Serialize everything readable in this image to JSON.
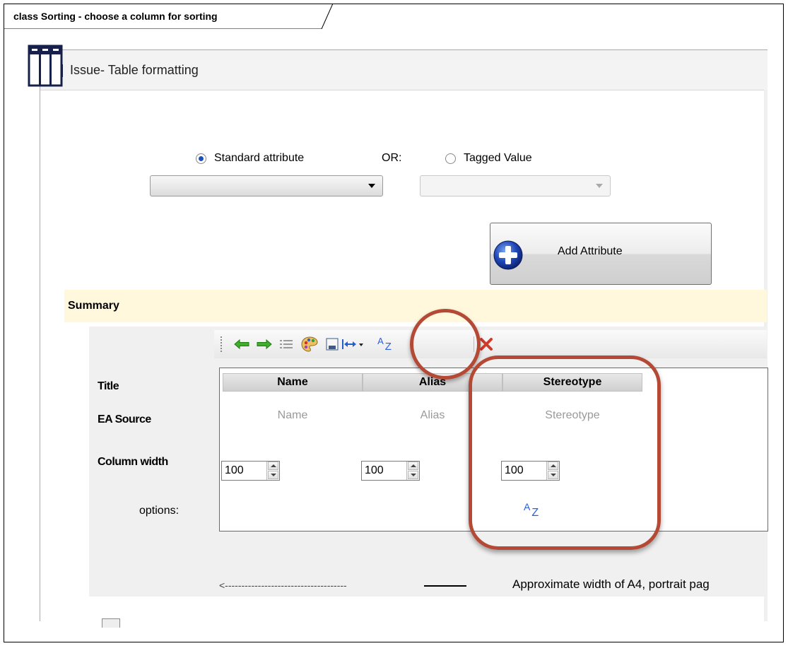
{
  "diagram": {
    "frame_label": "class Sorting - choose a column for sorting"
  },
  "dialog": {
    "title": "Issue- Table formatting",
    "icons": {
      "app": "ea-app-icon",
      "table_format": "table-columns-icon"
    },
    "attribute_source": {
      "standard_label": "Standard attribute",
      "standard_selected": true,
      "or_label": "OR:",
      "tagged_label": "Tagged Value",
      "tagged_selected": false,
      "standard_combo_value": "",
      "tagged_combo_value": ""
    },
    "add_attribute_label": "Add Attribute",
    "summary_label": "Summary",
    "toolbar": {
      "items": [
        "move-left-icon",
        "move-right-icon",
        "list-icon",
        "palette-icon",
        "save-icon",
        "column-width-icon",
        "sort-az-icon",
        "delete-icon"
      ],
      "sort_glyph_a": "A",
      "sort_glyph_z": "Z"
    },
    "row_labels": {
      "title": "Title",
      "source": "EA Source",
      "width": "Column width",
      "options": "options:"
    },
    "columns": [
      {
        "header": "Name",
        "source": "Name",
        "width": "100"
      },
      {
        "header": "Alias",
        "source": "Alias",
        "width": "100"
      },
      {
        "header": "Stereotype",
        "source": "Stereotype",
        "width": "100"
      }
    ],
    "sorted_column_option": {
      "a": "A",
      "z": "Z"
    },
    "width_indicator_dashes": "<-------------------------------------",
    "width_indicator_caption": "Approximate width of A4, portrait pag"
  },
  "colors": {
    "callout": "#b44a35",
    "summary_bg": "#fff8dd",
    "accent_blue": "#2a5fe0"
  }
}
